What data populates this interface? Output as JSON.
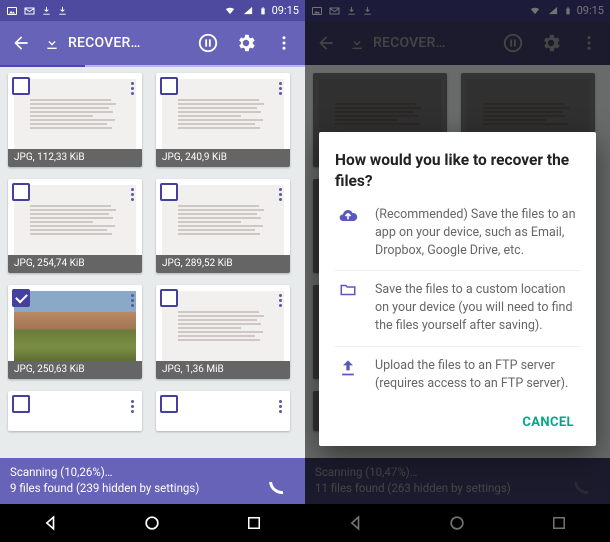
{
  "status": {
    "time": "09:15"
  },
  "appbar": {
    "title": "RECOVER…"
  },
  "left": {
    "items": [
      {
        "caption": "JPG, 112,33 KiB",
        "checked": false,
        "kind": "doc"
      },
      {
        "caption": "JPG, 240,9 KiB",
        "checked": false,
        "kind": "doc"
      },
      {
        "caption": "JPG, 254,74 KiB",
        "checked": false,
        "kind": "doc"
      },
      {
        "caption": "JPG, 289,52 KiB",
        "checked": false,
        "kind": "doc"
      },
      {
        "caption": "JPG, 250,63 KiB",
        "checked": true,
        "kind": "photo"
      },
      {
        "caption": "JPG, 1,36 MiB",
        "checked": false,
        "kind": "doc"
      }
    ],
    "scan_line": "Scanning (10,26%)…",
    "found_line": "9 files found (239 hidden by settings)"
  },
  "right": {
    "scan_line": "Scanning (10,47%)…",
    "found_line": "11 files found (263 hidden by settings)"
  },
  "dialog": {
    "title": "How would you like to recover the files?",
    "opt1": "(Recommended) Save the files to an app on your device, such as Email, Dropbox, Google Drive, etc.",
    "opt2": "Save the files to a custom location on your device (you will need to find the files yourself after saving).",
    "opt3": "Upload the files to an FTP server (requires access to an FTP server).",
    "cancel": "CANCEL"
  }
}
